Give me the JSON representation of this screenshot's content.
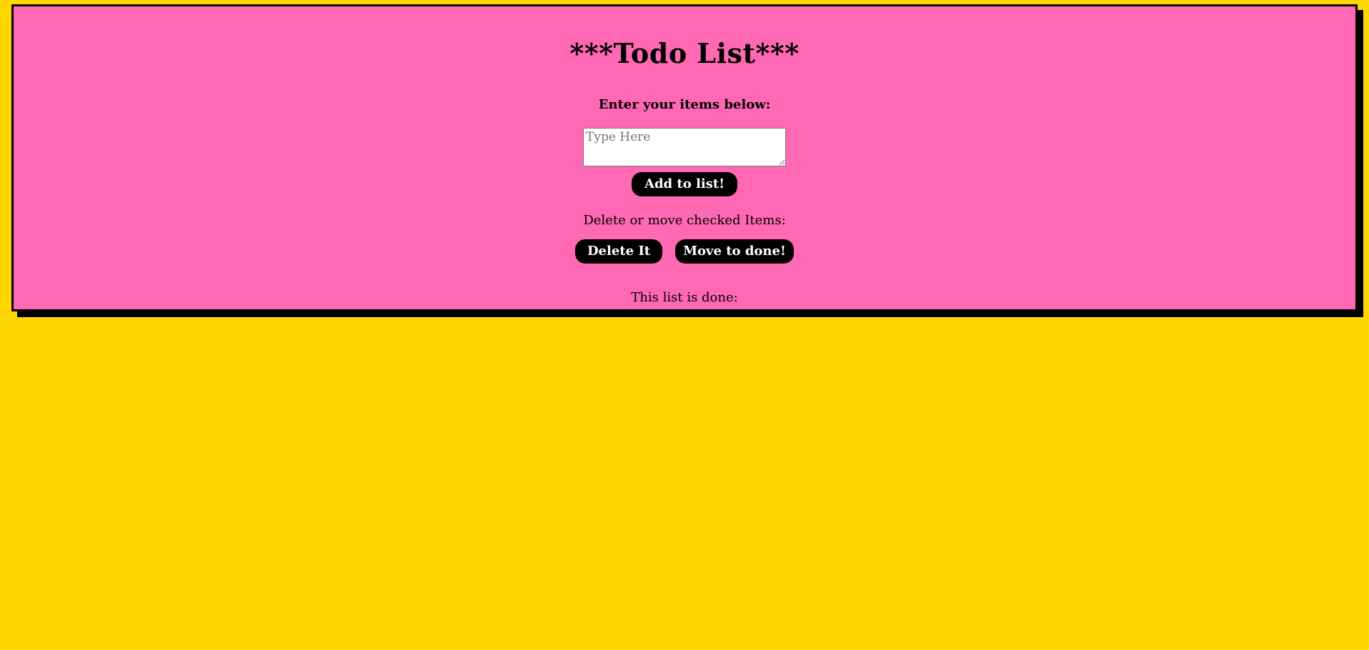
{
  "colors": {
    "page_background": "#FFD700",
    "card_background": "#FF69B4",
    "button_background": "#000000",
    "button_text": "#FFFFFF"
  },
  "header": {
    "title": "***Todo List***"
  },
  "entry": {
    "prompt": "Enter your items below:",
    "input_value": "",
    "input_placeholder": "Type Here",
    "add_button_label": "Add to list!"
  },
  "actions": {
    "prompt": "Delete or move checked Items:",
    "delete_button_label": "Delete It",
    "move_button_label": "Move to done!"
  },
  "done_section": {
    "label": "This list is done:"
  }
}
